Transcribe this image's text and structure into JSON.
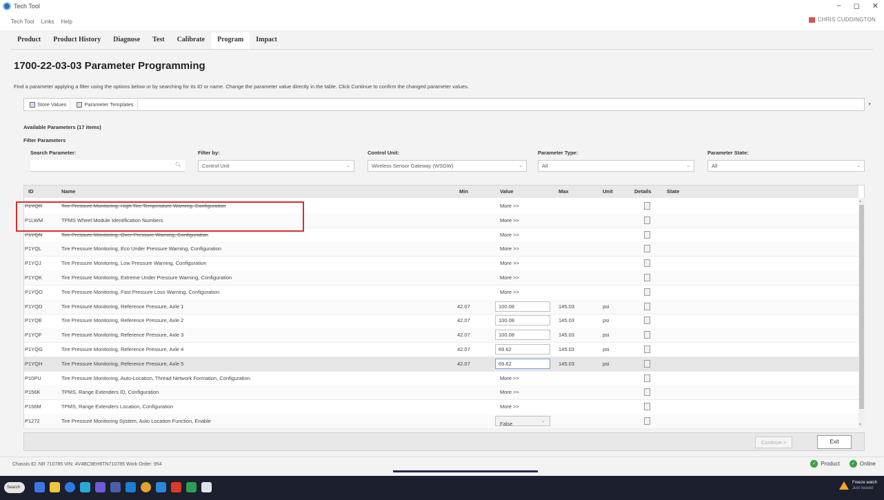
{
  "window": {
    "title": "Tech Tool",
    "controls": [
      "–",
      "◻",
      "✕"
    ]
  },
  "menu": [
    "Tech Tool",
    "Links",
    "Help"
  ],
  "user": {
    "name": "CHRIS CUDDINGTON"
  },
  "tabs": [
    "Product",
    "Product History",
    "Diagnose",
    "Test",
    "Calibrate",
    "Program",
    "Impact"
  ],
  "active_tab": "Program",
  "page": {
    "title": "1700-22-03-03 Parameter Programming",
    "description": "Find a parameter applying a filter using the options below or by searching for its ID or name. Change the parameter value directly in the table. Click Continue to confirm the changed parameter values."
  },
  "toolbar": {
    "store_values": "Store Values",
    "parameter_templates": "Parameter Templates"
  },
  "available": "Available Parameters (17 items)",
  "filters": {
    "title": "Filter Parameters",
    "search_label": "Search Parameter:",
    "search_value": "",
    "filter_by_label": "Filter by:",
    "filter_by_value": "Control Unit",
    "control_unit_label": "Control Unit:",
    "control_unit_value": "Wireless Sensor Gateway (WSGW)",
    "param_type_label": "Parameter Type:",
    "param_type_value": "All",
    "param_state_label": "Parameter State:",
    "param_state_value": "All"
  },
  "table": {
    "headers": {
      "id": "ID",
      "name": "Name",
      "min": "Min",
      "value": "Value",
      "max": "Max",
      "unit": "Unit",
      "details": "Details",
      "state": "State"
    },
    "rows": [
      {
        "id": "P1YQR",
        "name": "Tire Pressure Monitoring, High Tire Temperature Warning, Configuration",
        "min": "",
        "value": "More >>",
        "max": "",
        "unit": ""
      },
      {
        "id": "P1LWM",
        "name": "TPMS Wheel Module Identification Numbers",
        "min": "",
        "value": "More >>",
        "max": "",
        "unit": ""
      },
      {
        "id": "P1YQN",
        "name": "Tire Pressure Monitoring, Over Pressure Warning, Configuration",
        "min": "",
        "value": "More >>",
        "max": "",
        "unit": ""
      },
      {
        "id": "P1YQL",
        "name": "Tire Pressure Monitoring, Eco Under Pressure Warning, Configuration",
        "min": "",
        "value": "More >>",
        "max": "",
        "unit": ""
      },
      {
        "id": "P1YQJ",
        "name": "Tire Pressure Monitoring, Low Pressure Warning, Configuration",
        "min": "",
        "value": "More >>",
        "max": "",
        "unit": ""
      },
      {
        "id": "P1YQK",
        "name": "Tire Pressure Monitoring, Extreme Under Pressure Warning, Configuration",
        "min": "",
        "value": "More >>",
        "max": "",
        "unit": ""
      },
      {
        "id": "P1YQO",
        "name": "Tire Pressure Monitoring, Fast Pressure Loss Warning, Configuration",
        "min": "",
        "value": "More >>",
        "max": "",
        "unit": ""
      },
      {
        "id": "P1YQD",
        "name": "Tire Pressure Monitoring, Reference Pressure, Axle 1",
        "min": "42.07",
        "value": "100.08",
        "max": "145.03",
        "unit": "psi"
      },
      {
        "id": "P1YQE",
        "name": "Tire Pressure Monitoring, Reference Pressure, Axle 2",
        "min": "42.07",
        "value": "100.08",
        "max": "145.03",
        "unit": "psi"
      },
      {
        "id": "P1YQF",
        "name": "Tire Pressure Monitoring, Reference Pressure, Axle 3",
        "min": "42.07",
        "value": "100.08",
        "max": "145.03",
        "unit": "psi"
      },
      {
        "id": "P1YQG",
        "name": "Tire Pressure Monitoring, Reference Pressure, Axle 4",
        "min": "42.07",
        "value": "69.62",
        "max": "145.03",
        "unit": "psi"
      },
      {
        "id": "P1YQH",
        "name": "Tire Pressure Monitoring, Reference Pressure, Axle 5",
        "min": "42.07",
        "value": "69.62",
        "max": "145.03",
        "unit": "psi"
      },
      {
        "id": "P10PU",
        "name": "Tire Pressure Monitoring, Auto-Location, Thread Network Formation, Configuration",
        "min": "",
        "value": "More >>",
        "max": "",
        "unit": ""
      },
      {
        "id": "P156K",
        "name": "TPMS, Range Extenders ID, Configuration",
        "min": "",
        "value": "More >>",
        "max": "",
        "unit": ""
      },
      {
        "id": "P156M",
        "name": "TPMS, Range Extenders Location, Configuration",
        "min": "",
        "value": "More >>",
        "max": "",
        "unit": ""
      },
      {
        "id": "P1272",
        "name": "Tire Pressure Monitoring System, Auto Location Function, Enable",
        "min": "",
        "value": "False",
        "max": "",
        "unit": ""
      }
    ]
  },
  "buttons": {
    "continue": "Continue >",
    "exit": "Exit"
  },
  "status": {
    "info": "Chassis ID: NR 710785   VIN: 4V4BC9EH6TN710785   Work Order: 954",
    "product": "Product",
    "online": "Online"
  },
  "taskbar": {
    "search": "Search",
    "notify_title": "Freeze watch",
    "notify_sub": "Just issued"
  },
  "colors": {
    "highlight": "#d62c2c",
    "check": "#3aa040",
    "taskbar": "#1b1f2e"
  }
}
